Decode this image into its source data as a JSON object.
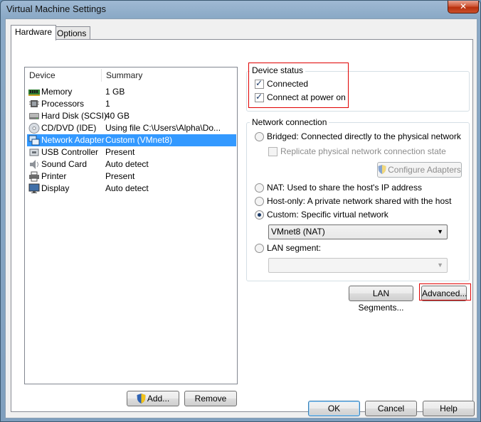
{
  "window": {
    "title": "Virtual Machine Settings",
    "close_glyph": "✕"
  },
  "tabs": [
    {
      "label": "Hardware"
    },
    {
      "label": "Options"
    }
  ],
  "device_list": {
    "columns": [
      "Device",
      "Summary"
    ],
    "rows": [
      {
        "device": "Memory",
        "summary": "1 GB",
        "icon": "memory-icon"
      },
      {
        "device": "Processors",
        "summary": "1",
        "icon": "processor-icon"
      },
      {
        "device": "Hard Disk (SCSI)",
        "summary": "40 GB",
        "icon": "hard-disk-icon"
      },
      {
        "device": "CD/DVD (IDE)",
        "summary": "Using file C:\\Users\\Alpha\\Do...",
        "icon": "cd-dvd-icon"
      },
      {
        "device": "Network Adapter",
        "summary": "Custom (VMnet8)",
        "icon": "network-adapter-icon"
      },
      {
        "device": "USB Controller",
        "summary": "Present",
        "icon": "usb-icon"
      },
      {
        "device": "Sound Card",
        "summary": "Auto detect",
        "icon": "sound-icon"
      },
      {
        "device": "Printer",
        "summary": "Present",
        "icon": "printer-icon"
      },
      {
        "device": "Display",
        "summary": "Auto detect",
        "icon": "display-icon"
      }
    ],
    "selected_index": 4
  },
  "list_buttons": {
    "add": "Add...",
    "remove": "Remove"
  },
  "device_status": {
    "title": "Device status",
    "connected": "Connected",
    "connect_at_power_on": "Connect at power on"
  },
  "network_connection": {
    "title": "Network connection",
    "bridged": "Bridged: Connected directly to the physical network",
    "replicate": "Replicate physical network connection state",
    "configure_adapters": "Configure Adapters",
    "nat": "NAT: Used to share the host's IP address",
    "host_only": "Host-only: A private network shared with the host",
    "custom": "Custom: Specific virtual network",
    "custom_selected": "VMnet8 (NAT)",
    "lan_segment": "LAN segment:",
    "lan_segment_selected": ""
  },
  "right_buttons": {
    "lan_segments": "LAN Segments...",
    "advanced": "Advanced..."
  },
  "dialog_buttons": {
    "ok": "OK",
    "cancel": "Cancel",
    "help": "Help"
  },
  "glyphs": {
    "check": "✓",
    "arrow": "▼"
  }
}
